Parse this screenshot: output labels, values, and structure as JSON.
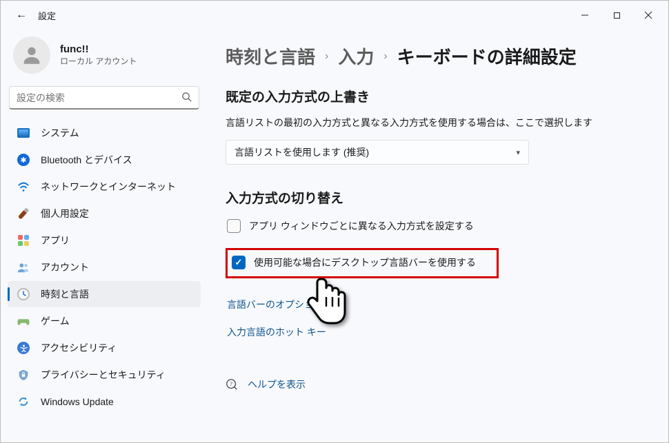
{
  "titlebar": {
    "back_icon": "←",
    "title": "設定"
  },
  "profile": {
    "username": "func!!",
    "account_type": "ローカル アカウント"
  },
  "search": {
    "placeholder": "設定の検索"
  },
  "sidebar": {
    "items": [
      {
        "icon": "system-icon",
        "label": "システム"
      },
      {
        "icon": "bluetooth-icon",
        "label": "Bluetooth とデバイス"
      },
      {
        "icon": "network-icon",
        "label": "ネットワークとインターネット"
      },
      {
        "icon": "personalization-icon",
        "label": "個人用設定"
      },
      {
        "icon": "apps-icon",
        "label": "アプリ"
      },
      {
        "icon": "accounts-icon",
        "label": "アカウント"
      },
      {
        "icon": "time-language-icon",
        "label": "時刻と言語"
      },
      {
        "icon": "gaming-icon",
        "label": "ゲーム"
      },
      {
        "icon": "accessibility-icon",
        "label": "アクセシビリティ"
      },
      {
        "icon": "privacy-icon",
        "label": "プライバシーとセキュリティ"
      },
      {
        "icon": "windows-update-icon",
        "label": "Windows Update"
      }
    ],
    "active_index": 6
  },
  "breadcrumb": {
    "seg0": "時刻と言語",
    "seg1": "入力",
    "current": "キーボードの詳細設定"
  },
  "sections": {
    "override": {
      "heading": "既定の入力方式の上書き",
      "description": "言語リストの最初の入力方式と異なる入力方式を使用する場合は、ここで選択します",
      "dropdown_value": "言語リストを使用します (推奨)"
    },
    "switching": {
      "heading": "入力方式の切り替え",
      "checkbox1": {
        "label": "アプリ ウィンドウごとに異なる入力方式を設定する",
        "checked": false
      },
      "checkbox2": {
        "label": "使用可能な場合にデスクトップ言語バーを使用する",
        "checked": true
      },
      "link1": "言語バーのオプション",
      "link2": "入力言語のホット キー"
    }
  },
  "help": {
    "label": "ヘルプを表示"
  },
  "colors": {
    "accent": "#0067c0",
    "highlight": "#d30000",
    "link": "#10548c"
  }
}
